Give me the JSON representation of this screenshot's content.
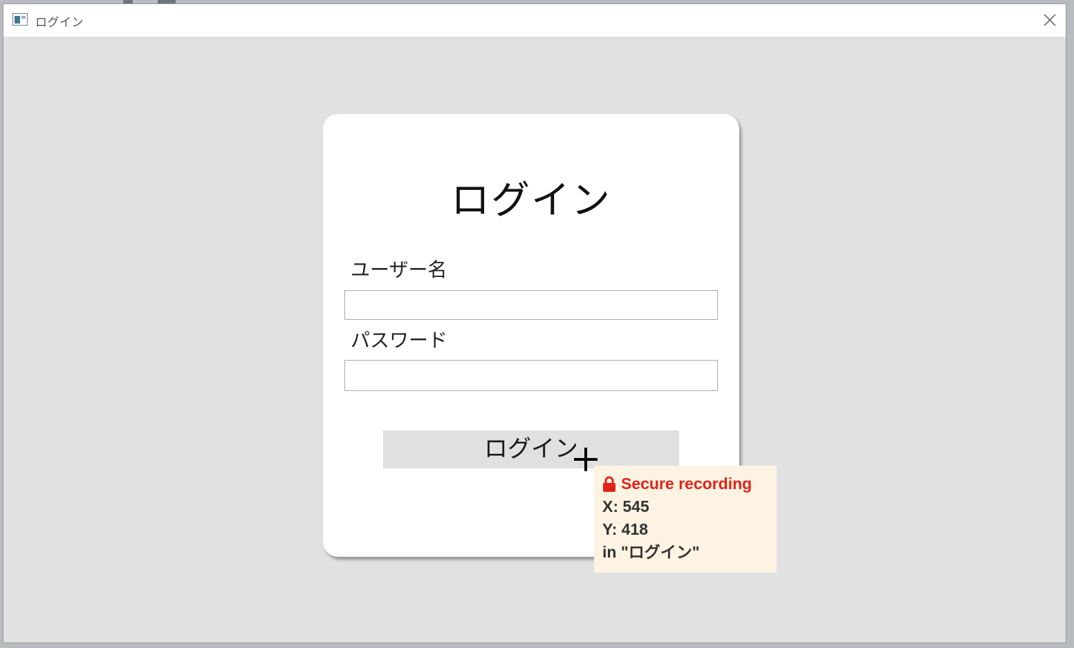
{
  "window": {
    "title": "ログイン",
    "icon": "app-window-icon",
    "close_icon": "close-icon"
  },
  "login_form": {
    "heading": "ログイン",
    "username_label": "ユーザー名",
    "username_value": "",
    "password_label": "パスワード",
    "password_value": "",
    "submit_label": "ログイン"
  },
  "recording_tooltip": {
    "status": "Secure recording",
    "status_icon": "lock-icon",
    "status_color": "#e2231a",
    "x_line": "X: 545",
    "y_line": "Y: 418",
    "target_line": "in \"ログイン\""
  },
  "cursor": {
    "icon": "crosshair-cursor-icon"
  }
}
